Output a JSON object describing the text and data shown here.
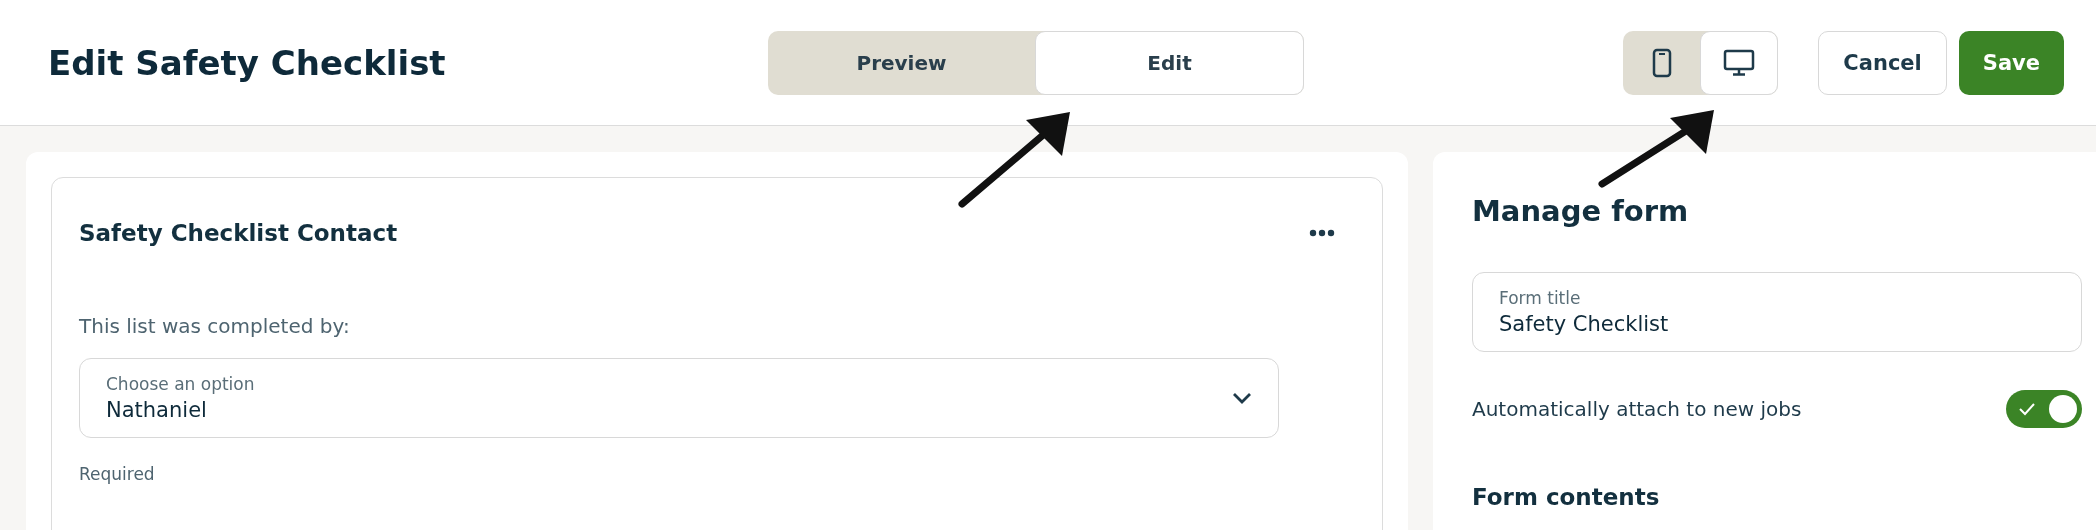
{
  "header": {
    "title": "Edit Safety Checklist",
    "mode_tabs": [
      {
        "label": "Preview",
        "selected": false
      },
      {
        "label": "Edit",
        "selected": true
      }
    ],
    "device_toggle": [
      {
        "kind": "phone",
        "selected": false
      },
      {
        "kind": "desktop",
        "selected": true
      }
    ],
    "buttons": [
      {
        "label": "Cancel",
        "kind": "secondary"
      },
      {
        "label": "Save",
        "kind": "primary"
      }
    ]
  },
  "form_card": {
    "title": "Safety Checklist Contact",
    "question": "This list was completed by:",
    "select": {
      "label": "Choose an option",
      "value": "Nathaniel"
    },
    "hint": "Required"
  },
  "manage_form": {
    "heading": "Manage form",
    "title_field": {
      "label": "Form title",
      "value": "Safety Checklist"
    },
    "auto_attach": {
      "label": "Automatically attach to new jobs",
      "on": true
    },
    "contents_heading": "Form contents"
  },
  "annotations": [
    {
      "kind": "arrow"
    },
    {
      "kind": "arrow"
    }
  ]
}
